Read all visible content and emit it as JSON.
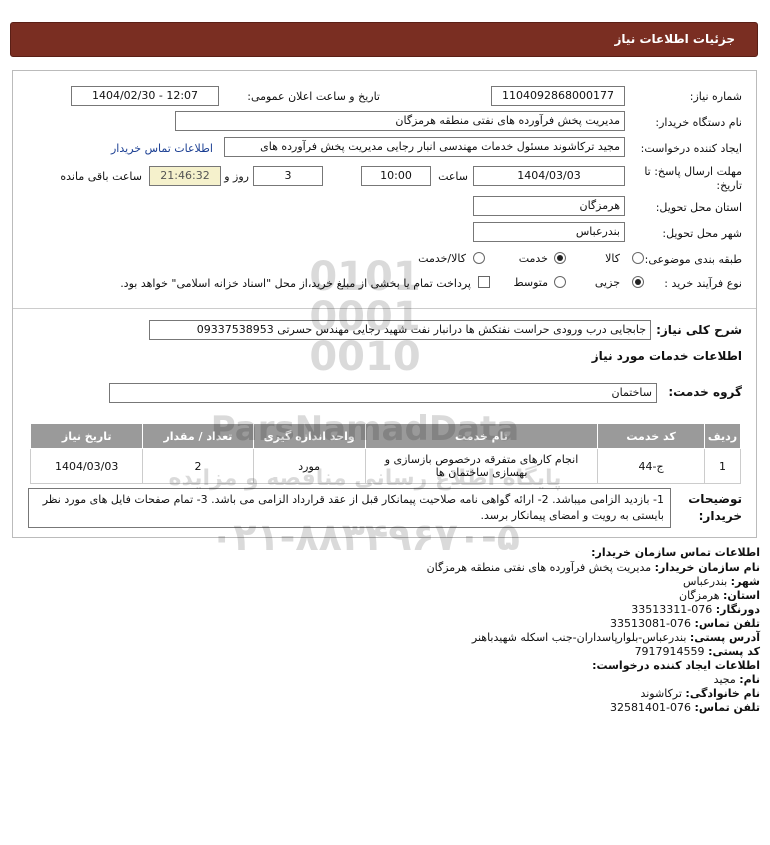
{
  "header": {
    "title": "جزئیات اطلاعات نیاز"
  },
  "form": {
    "need_number": {
      "label": "شماره نیاز:",
      "value": "1104092868000177"
    },
    "announce_datetime": {
      "label": "تاریخ و ساعت اعلان عمومی:",
      "value": "1404/02/30 - 12:07"
    },
    "buyer_org": {
      "label": "نام دستگاه خریدار:",
      "value": "مدیریت پخش فرآورده های نفتی منطقه هرمزگان"
    },
    "creator": {
      "label": "ایجاد کننده درخواست:",
      "value": "مجید ترکاشوند مسئول خدمات مهندسی انبار رجایی مدیریت پخش فرآورده های",
      "contact_link": "اطلاعات تماس خریدار"
    },
    "deadline": {
      "label_line1": "مهلت ارسال پاسخ: تا",
      "label_line2": "تاریخ:",
      "date": "1404/03/03",
      "time_label": "ساعت",
      "time": "10:00",
      "days": "3",
      "days_label": "روز و",
      "remaining": "21:46:32",
      "remaining_label": "ساعت باقی مانده"
    },
    "province": {
      "label": "استان محل تحویل:",
      "value": "هرمزگان"
    },
    "city": {
      "label": "شهر محل تحویل:",
      "value": "بندرعباس"
    },
    "category": {
      "label": "طبقه بندی موضوعی:",
      "options": [
        "کالا",
        "خدمت",
        "کالا/خدمت"
      ],
      "selected": "خدمت"
    },
    "purchase_type": {
      "label": "نوع فرآیند خرید :",
      "options": [
        "جزیی",
        "متوسط"
      ],
      "selected": "جزیی",
      "payment_note": "پرداخت تمام یا بخشی از مبلغ خرید،از محل \"اسناد خزانه اسلامی\" خواهد بود."
    }
  },
  "summary": {
    "label": "شرح کلی نیاز:",
    "value": "جابجایی درب ورودی حراست نفتکش ها درانبار نفت شهید رجایی مهندس حسرتی 09337538953"
  },
  "services": {
    "heading": "اطلاعات خدمات مورد نیاز",
    "group_label": "گروه خدمت:",
    "group_value": "ساختمان",
    "table": {
      "headers": [
        "ردیف",
        "کد خدمت",
        "نام خدمت",
        "واحد اندازه گیری",
        "تعداد / مقدار",
        "تاریخ نیاز"
      ],
      "rows": [
        {
          "row": "1",
          "code": "ج-44",
          "name": "انجام کارهای متفرقه درخصوص بازسازی و بهسازی ساختمان ها",
          "unit": "مورد",
          "qty": "2",
          "date": "1404/03/03"
        }
      ]
    }
  },
  "buyer_notes": {
    "label_line1": "توضیحات",
    "label_line2": "خریدار:",
    "text": "1- بازدید الزامی میباشد. 2- ارائه گواهی نامه صلاحیت پیمانکار قبل از عقد قرارداد الزامی می باشد. 3- تمام صفحات فایل های مورد نظر بایستی به رویت و امضای پیمانکار برسد."
  },
  "contact": {
    "org_heading": "اطلاعات تماس سازمان خریدار:",
    "buyer_name_label": "نام سازمان خریدار:",
    "buyer_name": "مدیریت پخش فرآورده های نفتی منطقه هرمزگان",
    "city_label": "شهر:",
    "city": "بندرعباس",
    "province_label": "استان:",
    "province": "هرمزگان",
    "fax_label": "دورنگار:",
    "fax": "076-33513311",
    "phone_label": "تلفن تماس:",
    "phone": "076-33513081",
    "address_label": "آدرس پستی:",
    "address": "بندرعباس-بلوارپاسداران-جنب اسکله شهیدباهنر",
    "postal_label": "کد پستی:",
    "postal": "7917914559",
    "creator_heading": "اطلاعات ایجاد کننده درخواست:",
    "first_name_label": "نام:",
    "first_name": "مجید",
    "last_name_label": "نام خانوادگی:",
    "last_name": "ترکاشوند",
    "creator_phone_label": "تلفن تماس:",
    "creator_phone": "076-32581401"
  },
  "watermark": {
    "brand": "ParsNamadData",
    "tagline": "پایگاه اطلاع رسانی مناقصه و مزایده",
    "phone": "۰۲۱-۸۸۳۴۹۶۷۰-۵"
  }
}
